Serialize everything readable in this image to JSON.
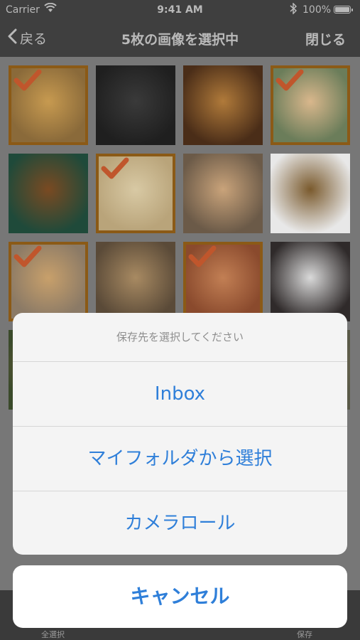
{
  "status_bar": {
    "carrier": "Carrier",
    "time": "9:41 AM",
    "battery": "100%"
  },
  "nav": {
    "back_label": "戻る",
    "title": "5枚の画像を選択中",
    "close_label": "閉じる"
  },
  "grid": {
    "photos": [
      {
        "name": "lion-1",
        "selected": true,
        "colors": [
          "#8a6a3a",
          "#c79a50"
        ]
      },
      {
        "name": "lion-2",
        "selected": false,
        "colors": [
          "#1f1f1f",
          "#3a3a3a"
        ]
      },
      {
        "name": "lion-3",
        "selected": false,
        "colors": [
          "#4a2d18",
          "#b07a3a"
        ]
      },
      {
        "name": "lion-4",
        "selected": true,
        "colors": [
          "#6b7d5a",
          "#d9b78c"
        ]
      },
      {
        "name": "lion-5",
        "selected": false,
        "colors": [
          "#1f4a3a",
          "#7a4a22"
        ]
      },
      {
        "name": "lion-6",
        "selected": true,
        "colors": [
          "#b9a47a",
          "#d8c9a4"
        ]
      },
      {
        "name": "lion-7",
        "selected": false,
        "colors": [
          "#6b5a48",
          "#c9a37a"
        ]
      },
      {
        "name": "lion-8",
        "selected": false,
        "colors": [
          "#e8e8e8",
          "#7a5a2d"
        ]
      },
      {
        "name": "lion-9",
        "selected": true,
        "colors": [
          "#8b7a66",
          "#c8a06b"
        ]
      },
      {
        "name": "lion-10",
        "selected": false,
        "colors": [
          "#5a4a38",
          "#a88a62"
        ]
      },
      {
        "name": "lion-11",
        "selected": true,
        "colors": [
          "#8a4a2d",
          "#c27f54"
        ]
      },
      {
        "name": "lion-12",
        "selected": false,
        "colors": [
          "#2f2a2a",
          "#d9d9d9"
        ]
      },
      {
        "name": "lion-13",
        "selected": false,
        "colors": [
          "#3a4a2a",
          "#8a6a48"
        ]
      },
      {
        "name": "lion-14",
        "selected": false,
        "colors": [
          "#6a5a48",
          "#9a7a5a"
        ]
      },
      {
        "name": "lion-15",
        "selected": false,
        "colors": [
          "#4a3a2a",
          "#8a6a48"
        ]
      },
      {
        "name": "lion-16",
        "selected": false,
        "colors": [
          "#5a5a48",
          "#8a7a62"
        ]
      }
    ]
  },
  "toolbar": {
    "select_all_label": "全選択",
    "save_label": "保存"
  },
  "sheet": {
    "title": "保存先を選択してください",
    "actions": [
      {
        "label": "Inbox"
      },
      {
        "label": "マイフォルダから選択"
      },
      {
        "label": "カメラロール"
      }
    ],
    "cancel_label": "キャンセル"
  },
  "colors": {
    "accent": "#2f7fd9",
    "selection_border": "#8b5a16",
    "check": "#c0562c"
  }
}
